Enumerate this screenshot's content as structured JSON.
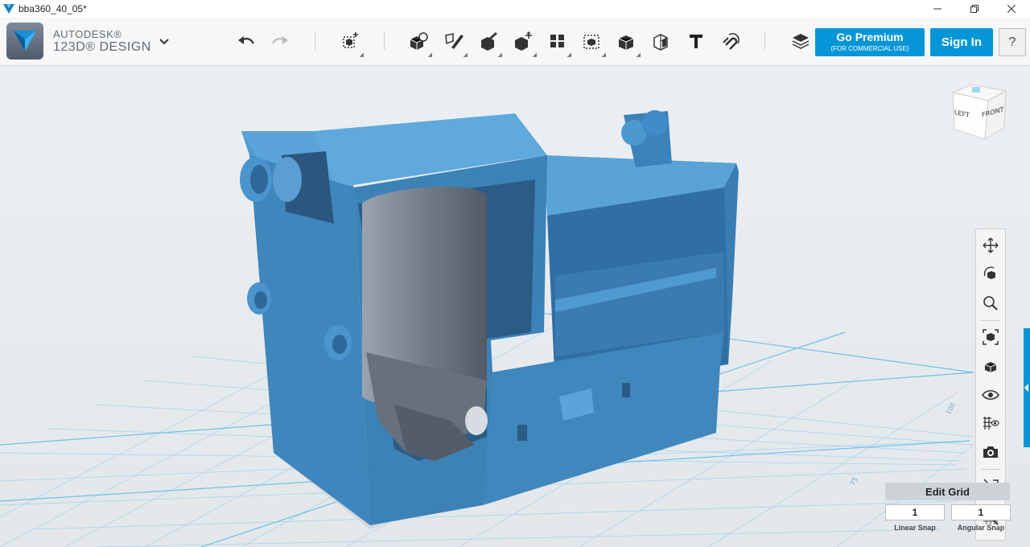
{
  "window": {
    "title": "bba360_40_05*",
    "controls": [
      "minimize",
      "restore",
      "close"
    ]
  },
  "brand": {
    "line1": "AUTODESK®",
    "line2": "123D® DESIGN"
  },
  "toolbar": {
    "premium_label": "Go Premium",
    "premium_sublabel": "(FOR COMMERCIAL USE)",
    "signin_label": "Sign In",
    "help_label": "?",
    "tools": [
      "undo",
      "redo",
      "transform",
      "primitives",
      "sketch",
      "construct",
      "modify",
      "pattern",
      "grouping",
      "combine",
      "measure",
      "text",
      "snap",
      "materials"
    ]
  },
  "viewcube": {
    "left_label": "LEFT",
    "front_label": "FRONT"
  },
  "grid_labels": {
    "label_a": "100",
    "label_b": "75"
  },
  "navbar": {
    "tools": [
      "pan",
      "orbit",
      "zoom",
      "fit",
      "views",
      "visibility",
      "material-view",
      "screenshot",
      "snap-mode",
      "hide-grid"
    ]
  },
  "grid_panel": {
    "edit_grid_label": "Edit Grid",
    "linear_snap_value": "1",
    "angular_snap_value": "1",
    "linear_snap_label": "Linear Snap",
    "angular_snap_label": "Angular Snap"
  },
  "colors": {
    "accent": "#0696d7",
    "model": "#3f88bd",
    "grid_line": "#7fc4e6"
  }
}
